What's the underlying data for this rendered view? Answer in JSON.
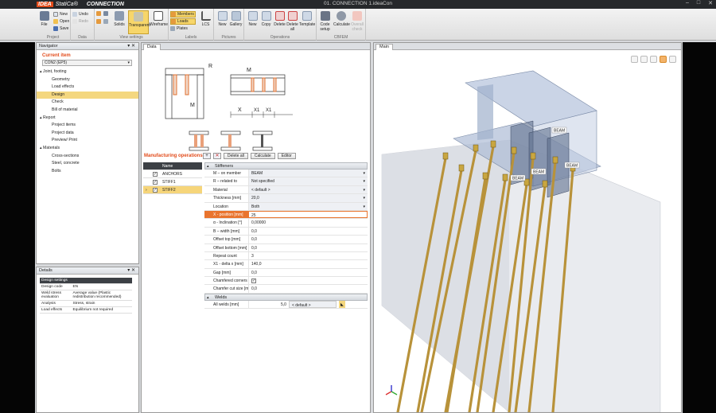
{
  "window": {
    "title": "01. CONNECTION 1.ideaCon",
    "brand_idea": "IDEA",
    "brand_statica": "StatiCa®",
    "brand_module": "CONNECTION"
  },
  "ribbon": {
    "groups": {
      "project": "Project",
      "data": "Data",
      "view_settings": "View settings",
      "labels": "Labels",
      "pictures": "Pictures",
      "operations": "Operations",
      "cbfem": "CBFEM"
    },
    "file": "File",
    "new": "New",
    "open": "Open",
    "save": "Save",
    "undo": "Undo",
    "redo": "Redo",
    "solids": "Solids",
    "transparent": "Transparent",
    "wireframe": "Wireframe",
    "members": "Members",
    "loads": "Loads",
    "plates": "Plates",
    "lcs": "LCS",
    "pic_new": "New",
    "gallery": "Gallery",
    "op_new": "New",
    "copy": "Copy",
    "delete": "Delete",
    "delete_all": "Delete all",
    "template": "Template",
    "code_setup": "Code setup",
    "calculate": "Calculate",
    "overall_check": "Overall check"
  },
  "navigator": {
    "title": "Navigator",
    "current_item_label": "Current item",
    "current_item_value": "CON2 (EP5)",
    "tree": [
      {
        "label": "Joint, footing",
        "level": 0
      },
      {
        "label": "Geometry",
        "level": 1
      },
      {
        "label": "Load effects",
        "level": 1
      },
      {
        "label": "Design",
        "level": 1,
        "selected": true
      },
      {
        "label": "Check",
        "level": 1
      },
      {
        "label": "Bill of material",
        "level": 1
      },
      {
        "label": "Report",
        "level": 0
      },
      {
        "label": "Project items",
        "level": 1
      },
      {
        "label": "Project data",
        "level": 1
      },
      {
        "label": "Preview/ Print",
        "level": 1
      },
      {
        "label": "Materials",
        "level": 0
      },
      {
        "label": "Cross-sections",
        "level": 1
      },
      {
        "label": "Steel, concrete",
        "level": 1
      },
      {
        "label": "Bolts",
        "level": 1
      }
    ]
  },
  "details": {
    "title": "Details",
    "header": "Design settings",
    "rows": [
      {
        "k": "Design code",
        "v": "EN"
      },
      {
        "k": "Weld stress evaluation",
        "v": "Average value (Plastic redistribution recommended)"
      },
      {
        "k": "Analysis",
        "v": "Stress, strain"
      },
      {
        "k": "Load effects",
        "v": "Equilibrium not required"
      }
    ]
  },
  "data_tab": "Data",
  "main_tab": "Main",
  "drawing_labels": {
    "r": "R",
    "m": "M",
    "m2": "M",
    "x": "X",
    "x1a": "X1",
    "x1b": "X1"
  },
  "manufacturing": {
    "title": "Manufacturing operations",
    "delete_all": "Delete all",
    "calculate": "Calculate",
    "editor": "Editor",
    "list_header": "Name",
    "items": [
      {
        "name": "ANCHORS",
        "checked": true
      },
      {
        "name": "STIFF1",
        "checked": true
      },
      {
        "name": "STIFF2",
        "checked": true,
        "selected": true
      }
    ]
  },
  "properties": {
    "group_stiffeners": "Stiffeners",
    "rows": [
      {
        "label": "M – on member",
        "value": "BEAM",
        "dropdown": true
      },
      {
        "label": "R – related to",
        "value": "Not specified",
        "dropdown": true
      },
      {
        "label": "Material",
        "value": "< default >",
        "dropdown": true
      },
      {
        "label": "Thickness [mm]",
        "value": "20,0",
        "dropdown": true
      },
      {
        "label": "Location",
        "value": "Both",
        "dropdown": true
      },
      {
        "label": "X - position [mm]",
        "value": "25",
        "highlight": true
      },
      {
        "label": "α - Inclination [°]",
        "value": "0,00000"
      },
      {
        "label": "B – width [mm]",
        "value": "0,0"
      },
      {
        "label": "Offset top [mm]",
        "value": "0,0"
      },
      {
        "label": "Offset bottom [mm]",
        "value": "0,0"
      },
      {
        "label": "Repeat count",
        "value": "3"
      },
      {
        "label": "X1 - delta x [mm]",
        "value": "140,0"
      },
      {
        "label": "Gap [mm]",
        "value": "0,0"
      },
      {
        "label": "Chamfered corners",
        "value": "",
        "checkbox": true
      },
      {
        "label": "Chamfer cut size [mm]",
        "value": "0,0"
      }
    ],
    "group_welds": "Welds",
    "welds_label": "All welds [mm]",
    "welds_value": "5,0",
    "welds_material": "< default >"
  },
  "scene_labels": {
    "beam1": "BEAM",
    "beam2": "BEAM",
    "beam3": "BEAM",
    "beam4": "BEAM"
  },
  "colors": {
    "accent": "#e24b1a",
    "selection": "#f6d57a",
    "highlight": "#e9742e",
    "anchor": "#b8923a"
  }
}
